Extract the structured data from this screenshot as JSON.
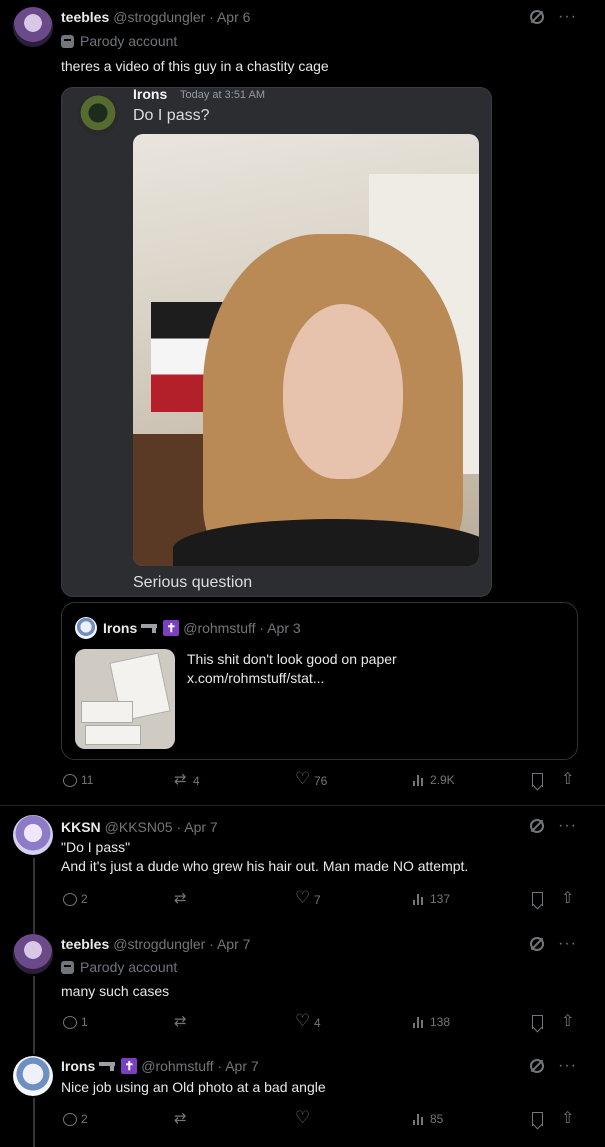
{
  "posts": [
    {
      "name": "teebles",
      "handle": "@strogdungler · Apr 6",
      "badge": "Parody account",
      "text": "theres a video of this guy in a chastity cage",
      "discord": {
        "name": "Irons",
        "time": "Today at 3:51 AM",
        "message": "Do I pass?",
        "caption": "Serious question"
      },
      "quote": {
        "name": "Irons",
        "handle": "@rohmstuff · Apr 3",
        "text": "This shit don't look good on paper\nx.com/rohmstuff/stat..."
      },
      "stats": {
        "replies": "11",
        "reposts": "4",
        "likes": "76",
        "views": "2.9K"
      }
    },
    {
      "name": "KKSN",
      "handle": "@KKSN05 · Apr 7",
      "text": "\"Do I pass\"\nAnd it's just a dude who grew his hair out. Man made NO attempt.",
      "stats": {
        "replies": "2",
        "reposts": "",
        "likes": "7",
        "views": "137"
      }
    },
    {
      "name": "teebles",
      "handle": "@strogdungler · Apr 7",
      "badge": "Parody account",
      "text": "many such cases",
      "stats": {
        "replies": "1",
        "reposts": "",
        "likes": "4",
        "views": "138"
      }
    },
    {
      "name": "Irons",
      "handle": "@rohmstuff · Apr 7",
      "text": "Nice job using an Old photo at a bad angle",
      "stats": {
        "replies": "2",
        "reposts": "",
        "likes": "",
        "views": "85"
      }
    }
  ],
  "icons": {
    "cross_glyph": "✝",
    "more_glyph": "···"
  },
  "colors": {
    "background": "#000000",
    "muted": "#71767b",
    "text": "#e7e9ea",
    "discord_bg": "#2b2d31",
    "cross_badge": "#7b3fbf"
  }
}
